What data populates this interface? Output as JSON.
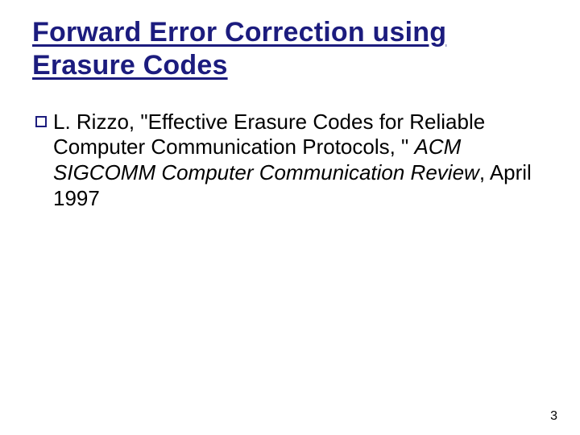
{
  "title": "Forward Error Correction using Erasure Codes",
  "bullets": [
    {
      "pre": "L. Rizzo, \"Effective Erasure Codes for Reliable Computer Communication Protocols, \" ",
      "italic": "ACM SIGCOMM Computer Communication Review",
      "post": ", April 1997"
    }
  ],
  "page_number": "3"
}
